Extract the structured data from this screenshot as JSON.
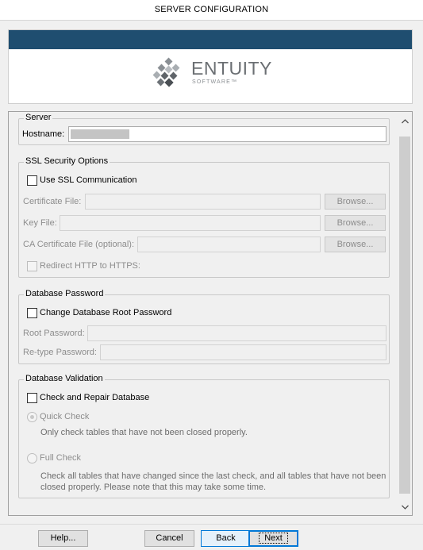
{
  "window": {
    "title": "SERVER CONFIGURATION"
  },
  "banner": {
    "brand": "ENTUITY",
    "brand_sub": "SOFTWARE™",
    "bar_color": "#1f4e70"
  },
  "server": {
    "legend": "Server",
    "hostname_label": "Hostname:",
    "hostname_value": ""
  },
  "ssl": {
    "legend": "SSL Security Options",
    "use_ssl_label": "Use SSL Communication",
    "use_ssl_checked": false,
    "cert_label": "Certificate File:",
    "key_label": "Key File:",
    "ca_label": "CA Certificate File (optional):",
    "browse_label": "Browse...",
    "redirect_label": "Redirect HTTP to HTTPS:"
  },
  "db_password": {
    "legend": "Database Password",
    "change_label": "Change Database Root Password",
    "change_checked": false,
    "root_label": "Root Password:",
    "retype_label": "Re-type Password:"
  },
  "db_validation": {
    "legend": "Database Validation",
    "check_label": "Check and Repair Database",
    "check_checked": false,
    "quick_label": "Quick Check",
    "quick_desc": "Only check tables that have not been closed properly.",
    "full_label": "Full Check",
    "full_desc_1": "Check all tables that have changed since the last check, and all tables that have not been",
    "full_desc_2": "closed properly. Please note that this may take some time.",
    "selected_option": "Quick Check"
  },
  "buttons": {
    "help": "Help...",
    "cancel": "Cancel",
    "back": "Back",
    "next": "Next"
  },
  "icons": {
    "scroll_up": "chevron-up-icon",
    "scroll_down": "chevron-down-icon",
    "logo": "entuity-logo-icon"
  }
}
